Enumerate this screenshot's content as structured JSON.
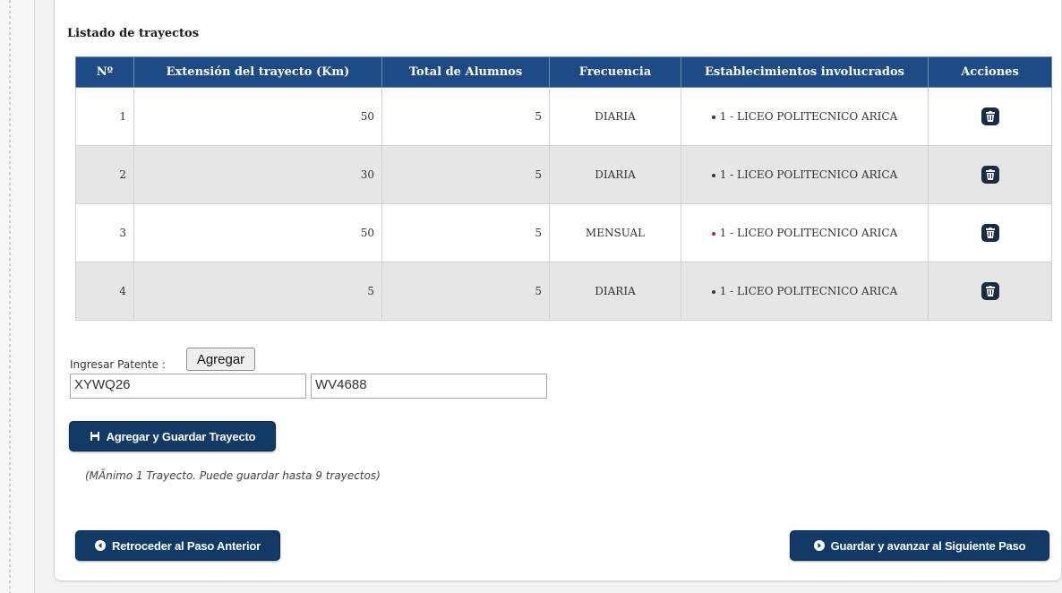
{
  "section": {
    "title": "Listado de trayectos"
  },
  "table": {
    "headers": [
      "Nº",
      "Extensión del trayecto (Km)",
      "Total de Alumnos",
      "Frecuencia",
      "Establecimientos involucrados",
      "Acciones"
    ],
    "rows": [
      {
        "n": "1",
        "km": "50",
        "alumnos": "5",
        "frecuencia": "DIARIA",
        "establecimiento": "1 - LICEO POLITECNICO ARICA"
      },
      {
        "n": "2",
        "km": "30",
        "alumnos": "5",
        "frecuencia": "DIARIA",
        "establecimiento": "1 - LICEO POLITECNICO ARICA"
      },
      {
        "n": "3",
        "km": "50",
        "alumnos": "5",
        "frecuencia": "MENSUAL",
        "establecimiento": "1 - LICEO POLITECNICO ARICA"
      },
      {
        "n": "4",
        "km": "5",
        "alumnos": "5",
        "frecuencia": "DIARIA",
        "establecimiento": "1 - LICEO POLITECNICO ARICA"
      }
    ],
    "action_icon": "trash-icon"
  },
  "patente": {
    "label": "Ingresar Patente :",
    "add_label": "Agregar",
    "values": [
      "XYWQ26",
      "WV4688"
    ]
  },
  "buttons": {
    "save_route": "Agregar y Guardar Trayecto",
    "back": "Retroceder al Paso Anterior",
    "next": "Guardar y avanzar al Siguiente Paso"
  },
  "hint": "(MÃnimo 1 Trayecto. Puede guardar hasta 9 trayectos)",
  "colors": {
    "header_bg": "#1e4b86",
    "button_bg": "#123a66",
    "alt_row": "#e6e6e6"
  }
}
